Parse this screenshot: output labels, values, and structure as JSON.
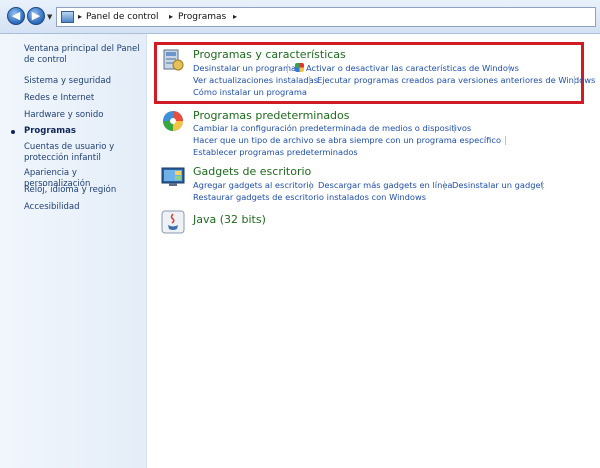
{
  "breadcrumb": {
    "items": [
      "Panel de control",
      "Programas"
    ]
  },
  "sidebar": {
    "items": [
      {
        "label": "Ventana principal del Panel de control"
      },
      {
        "label": "Sistema y seguridad"
      },
      {
        "label": "Redes e Internet"
      },
      {
        "label": "Hardware y sonido"
      },
      {
        "label": "Programas",
        "current": true
      },
      {
        "label": "Cuentas de usuario y protección infantil"
      },
      {
        "label": "Apariencia y personalización"
      },
      {
        "label": "Reloj, idioma y región"
      },
      {
        "label": "Accesibilidad"
      }
    ]
  },
  "sections": {
    "programs": {
      "title": "Programas y características",
      "links": [
        "Desinstalar un programa",
        "Activar o desactivar las características de Windows",
        "Ver actualizaciones instaladas",
        "Ejecutar programas creados para versiones anteriores de Windows",
        "Cómo instalar un programa"
      ]
    },
    "defaults": {
      "title": "Programas predeterminados",
      "links": [
        "Cambiar la configuración predeterminada de medios o dispositivos",
        "Hacer que un tipo de archivo se abra siempre con un programa específico",
        "Establecer programas predeterminados"
      ]
    },
    "gadgets": {
      "title": "Gadgets de escritorio",
      "links": [
        "Agregar gadgets al escritorio",
        "Descargar más gadgets en línea",
        "Desinstalar un gadget",
        "Restaurar gadgets de escritorio instalados con Windows"
      ]
    },
    "java": {
      "title": "Java (32 bits)"
    }
  },
  "colors": {
    "highlight": "#d01b24",
    "link": "#1f4fa8",
    "section_title": "#1e6a1e"
  }
}
